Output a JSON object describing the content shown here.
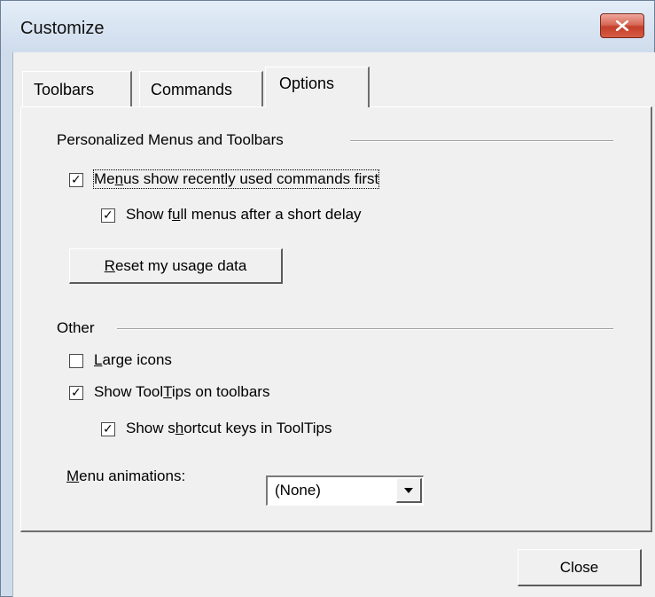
{
  "window": {
    "title": "Customize",
    "close_icon": "close-x-icon"
  },
  "tabs": [
    {
      "label": "Toolbars",
      "active": false
    },
    {
      "label": "Commands",
      "active": false
    },
    {
      "label": "Options",
      "active": true
    }
  ],
  "personalized": {
    "group_title": "Personalized Menus and Toolbars",
    "menus_recent": {
      "pre": "Me",
      "accel": "n",
      "post": "us show recently used commands first",
      "checked": true
    },
    "full_menus": {
      "pre": "Show f",
      "accel": "u",
      "post": "ll menus after a short delay",
      "checked": true
    },
    "reset_button": {
      "pre": "",
      "accel": "R",
      "post": "eset my usage data"
    }
  },
  "other": {
    "group_title": "Other",
    "large_icons": {
      "pre": "",
      "accel": "L",
      "post": "arge icons",
      "checked": false
    },
    "show_tooltips": {
      "pre": "Show Tool",
      "accel": "T",
      "post": "ips on toolbars",
      "checked": true
    },
    "shortcut_keys": {
      "pre": "Show s",
      "accel": "h",
      "post": "ortcut keys in ToolTips",
      "checked": true
    },
    "menu_animations": {
      "label_pre": "",
      "label_accel": "M",
      "label_post": "enu animations:",
      "selected": "(None)"
    }
  },
  "footer": {
    "close_label": "Close"
  }
}
